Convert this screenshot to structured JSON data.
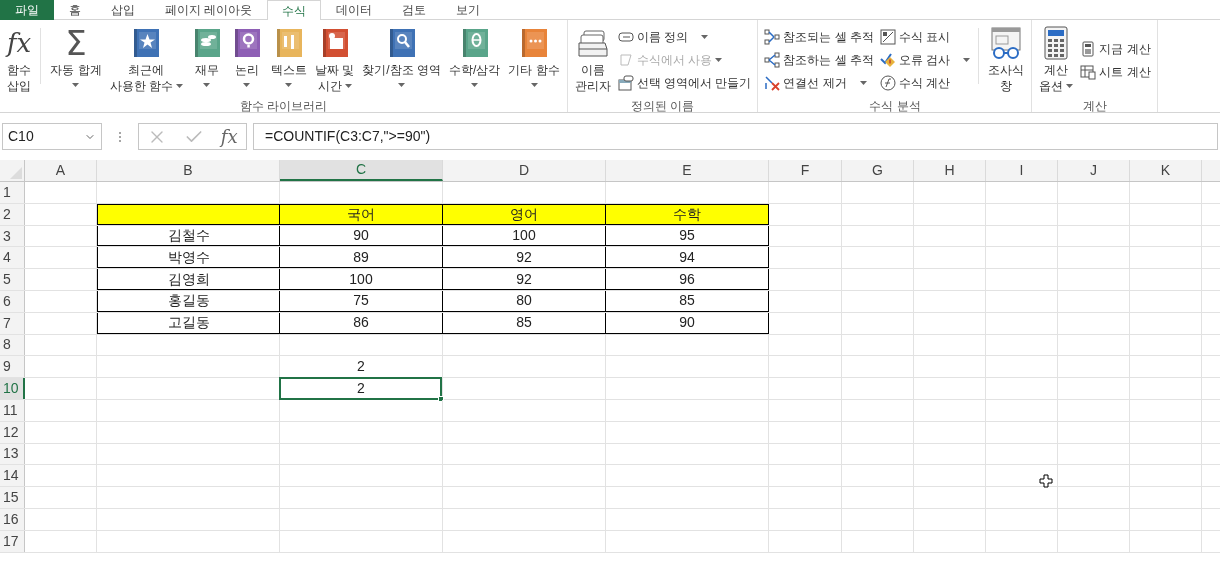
{
  "tabs": [
    {
      "label": "파일",
      "kind": "file",
      "selected": false
    },
    {
      "label": "홈",
      "kind": "tab",
      "selected": false
    },
    {
      "label": "삽입",
      "kind": "tab",
      "selected": false
    },
    {
      "label": "페이지 레이아웃",
      "kind": "tab",
      "selected": false
    },
    {
      "label": "수식",
      "kind": "tab",
      "selected": true
    },
    {
      "label": "데이터",
      "kind": "tab",
      "selected": false
    },
    {
      "label": "검토",
      "kind": "tab",
      "selected": false
    },
    {
      "label": "보기",
      "kind": "tab",
      "selected": false
    }
  ],
  "ribbon": {
    "groups": [
      {
        "label": "함수 라이브러리",
        "items": [
          {
            "kind": "large",
            "glyph": "fx",
            "lines": [
              "함수",
              "삽입"
            ],
            "dropdown": false
          },
          {
            "kind": "separator"
          },
          {
            "kind": "large",
            "glyph": "Σ",
            "lines": [
              "자동 합계"
            ],
            "dropdown": true
          },
          {
            "kind": "large",
            "lines": [
              "최근에",
              "사용한 함수"
            ],
            "dropdown": true
          },
          {
            "kind": "large",
            "lines": [
              "재무"
            ],
            "dropdown": true
          },
          {
            "kind": "large",
            "lines": [
              "논리"
            ],
            "dropdown": true
          },
          {
            "kind": "large",
            "lines": [
              "텍스트"
            ],
            "dropdown": true
          },
          {
            "kind": "large",
            "lines": [
              "날짜 및",
              "시간"
            ],
            "dropdown": true
          },
          {
            "kind": "large",
            "lines": [
              "찾기/참조 영역"
            ],
            "dropdown": true
          },
          {
            "kind": "large",
            "lines": [
              "수학/삼각"
            ],
            "dropdown": true
          },
          {
            "kind": "large",
            "lines": [
              "기타 함수"
            ],
            "dropdown": true
          }
        ]
      },
      {
        "label": "정의된 이름",
        "items": [
          {
            "kind": "large",
            "lines": [
              "이름",
              "관리자"
            ],
            "dropdown": false
          },
          {
            "kind": "stack",
            "items": [
              {
                "label": "이름 정의",
                "dropdown": true,
                "disabled": false
              },
              {
                "label": "수식에서 사용",
                "dropdown": true,
                "disabled": true
              },
              {
                "label": "선택 영역에서 만들기",
                "dropdown": false,
                "disabled": false
              }
            ]
          }
        ]
      },
      {
        "label": "수식 분석",
        "items": [
          {
            "kind": "stack",
            "items": [
              {
                "label": "참조되는 셀 추적",
                "dropdown": false,
                "disabled": false
              },
              {
                "label": "참조하는 셀 추적",
                "dropdown": false,
                "disabled": false
              },
              {
                "label": "연결선 제거",
                "dropdown": true,
                "disabled": false
              }
            ]
          },
          {
            "kind": "stack",
            "items": [
              {
                "label": "수식 표시",
                "dropdown": false,
                "disabled": false
              },
              {
                "label": "오류 검사",
                "dropdown": true,
                "disabled": false
              },
              {
                "label": "수식 계산",
                "dropdown": false,
                "disabled": false
              }
            ]
          },
          {
            "kind": "separator"
          },
          {
            "kind": "large",
            "lines": [
              "조사식",
              "창"
            ],
            "dropdown": false
          }
        ]
      },
      {
        "label": "계산",
        "items": [
          {
            "kind": "large",
            "lines": [
              "계산",
              "옵션"
            ],
            "dropdown": true
          },
          {
            "kind": "stack",
            "items": [
              {
                "label": "지금 계산",
                "dropdown": false,
                "disabled": false
              },
              {
                "label": "시트 계산",
                "dropdown": false,
                "disabled": false
              }
            ]
          }
        ]
      }
    ]
  },
  "formula_bar": {
    "name_box": "C10",
    "fx": "fx",
    "formula": "=COUNTIF(C3:C7,\">=90\")"
  },
  "sheet": {
    "columns": [
      {
        "label": "A",
        "selected": false
      },
      {
        "label": "B",
        "selected": false
      },
      {
        "label": "C",
        "selected": true
      },
      {
        "label": "D",
        "selected": false
      },
      {
        "label": "E",
        "selected": false
      },
      {
        "label": "F",
        "selected": false
      },
      {
        "label": "G",
        "selected": false
      },
      {
        "label": "H",
        "selected": false
      },
      {
        "label": "I",
        "selected": false
      },
      {
        "label": "J",
        "selected": false
      },
      {
        "label": "K",
        "selected": false
      }
    ],
    "rows": [
      {
        "number": "1",
        "selected": false,
        "kind": "plain",
        "cells": {}
      },
      {
        "number": "2",
        "selected": false,
        "kind": "header",
        "cells": {
          "c": "국어",
          "d": "영어",
          "e": "수학"
        }
      },
      {
        "number": "3",
        "selected": false,
        "kind": "table",
        "cells": {
          "b": "김철수",
          "c": "90",
          "d": "100",
          "e": "95"
        }
      },
      {
        "number": "4",
        "selected": false,
        "kind": "table",
        "cells": {
          "b": "박영수",
          "c": "89",
          "d": "92",
          "e": "94"
        }
      },
      {
        "number": "5",
        "selected": false,
        "kind": "table",
        "cells": {
          "b": "김영희",
          "c": "100",
          "d": "92",
          "e": "96"
        }
      },
      {
        "number": "6",
        "selected": false,
        "kind": "table",
        "cells": {
          "b": "홍길동",
          "c": "75",
          "d": "80",
          "e": "85"
        }
      },
      {
        "number": "7",
        "selected": false,
        "kind": "table",
        "cells": {
          "b": "고길동",
          "c": "86",
          "d": "85",
          "e": "90"
        }
      },
      {
        "number": "8",
        "selected": false,
        "kind": "plain",
        "cells": {}
      },
      {
        "number": "9",
        "selected": false,
        "kind": "plain",
        "cells": {
          "c": "2"
        }
      },
      {
        "number": "10",
        "selected": true,
        "kind": "plain",
        "cells": {
          "c": "2"
        }
      },
      {
        "number": "11",
        "selected": false,
        "kind": "plain",
        "cells": {}
      },
      {
        "number": "12",
        "selected": false,
        "kind": "plain",
        "cells": {}
      },
      {
        "number": "13",
        "selected": false,
        "kind": "plain",
        "cells": {}
      },
      {
        "number": "14",
        "selected": false,
        "kind": "plain",
        "cells": {}
      },
      {
        "number": "15",
        "selected": false,
        "kind": "plain",
        "cells": {}
      },
      {
        "number": "16",
        "selected": false,
        "kind": "plain",
        "cells": {}
      },
      {
        "number": "17",
        "selected": false,
        "kind": "plain",
        "cells": {}
      }
    ]
  }
}
